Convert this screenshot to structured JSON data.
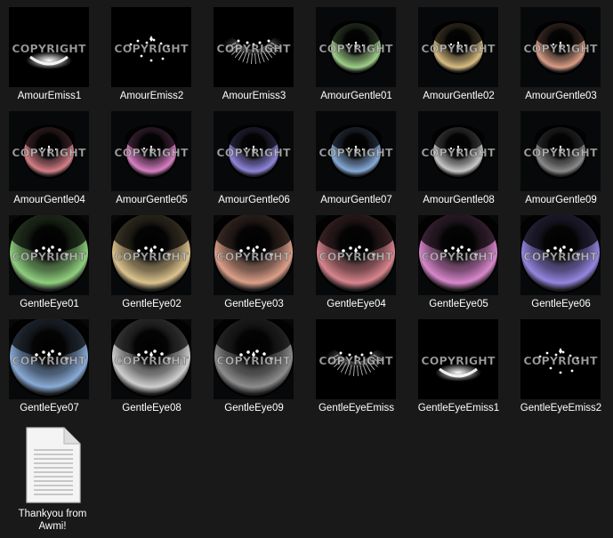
{
  "window": {
    "background": "#191919"
  },
  "files": [
    {
      "name": "AmourEmiss1",
      "type": "emiss-glow",
      "color": "#ffffff",
      "watermark": "COPYRIGHT"
    },
    {
      "name": "AmourEmiss2",
      "type": "emiss-sparkle",
      "color": "#ffffff",
      "watermark": "COPYRIGHT"
    },
    {
      "name": "AmourEmiss3",
      "type": "emiss-rim",
      "color": "#ffffff",
      "watermark": "COPYRIGHT"
    },
    {
      "name": "AmourGentle01",
      "type": "eye-small",
      "color": "#9fcf8a",
      "watermark": "COPYRIGHT"
    },
    {
      "name": "AmourGentle02",
      "type": "eye-small",
      "color": "#d9bd82",
      "watermark": "COPYRIGHT"
    },
    {
      "name": "AmourGentle03",
      "type": "eye-small",
      "color": "#d99d86",
      "watermark": "COPYRIGHT"
    },
    {
      "name": "AmourGentle04",
      "type": "eye-small",
      "color": "#d47f88",
      "watermark": "COPYRIGHT"
    },
    {
      "name": "AmourGentle05",
      "type": "eye-small",
      "color": "#d97fc4",
      "watermark": "COPYRIGHT"
    },
    {
      "name": "AmourGentle06",
      "type": "eye-small",
      "color": "#8e86db",
      "watermark": "COPYRIGHT"
    },
    {
      "name": "AmourGentle07",
      "type": "eye-small",
      "color": "#86aad8",
      "watermark": "COPYRIGHT"
    },
    {
      "name": "AmourGentle08",
      "type": "eye-small",
      "color": "#c8c8c8",
      "watermark": "COPYRIGHT"
    },
    {
      "name": "AmourGentle09",
      "type": "eye-small",
      "color": "#8a8a8a",
      "watermark": "COPYRIGHT"
    },
    {
      "name": "GentleEye01",
      "type": "eye-large",
      "color": "#8fcf7f",
      "watermark": "COPYRIGHT"
    },
    {
      "name": "GentleEye02",
      "type": "eye-large",
      "color": "#dcc38e",
      "watermark": "COPYRIGHT"
    },
    {
      "name": "GentleEye03",
      "type": "eye-large",
      "color": "#dca08a",
      "watermark": "COPYRIGHT"
    },
    {
      "name": "GentleEye04",
      "type": "eye-large",
      "color": "#d9858e",
      "watermark": "COPYRIGHT"
    },
    {
      "name": "GentleEye05",
      "type": "eye-large",
      "color": "#d987cc",
      "watermark": "COPYRIGHT"
    },
    {
      "name": "GentleEye06",
      "type": "eye-large",
      "color": "#9486e0",
      "watermark": "COPYRIGHT"
    },
    {
      "name": "GentleEye07",
      "type": "eye-large",
      "color": "#89abd6",
      "watermark": "COPYRIGHT"
    },
    {
      "name": "GentleEye08",
      "type": "eye-large",
      "color": "#cfcfcf",
      "watermark": "COPYRIGHT"
    },
    {
      "name": "GentleEye09",
      "type": "eye-large",
      "color": "#8d8d8d",
      "watermark": "COPYRIGHT"
    },
    {
      "name": "GentleEyeEmiss",
      "type": "emiss-rim",
      "color": "#ffffff",
      "watermark": "COPYRIGHT"
    },
    {
      "name": "GentleEyeEmiss1",
      "type": "emiss-glow",
      "color": "#ffffff",
      "watermark": "COPYRIGHT"
    },
    {
      "name": "GentleEyeEmiss2",
      "type": "emiss-sparkle",
      "color": "#ffffff",
      "watermark": "COPYRIGHT"
    }
  ],
  "text_file": {
    "name": "Thankyou from Awmi!",
    "icon": "text-document-icon"
  }
}
